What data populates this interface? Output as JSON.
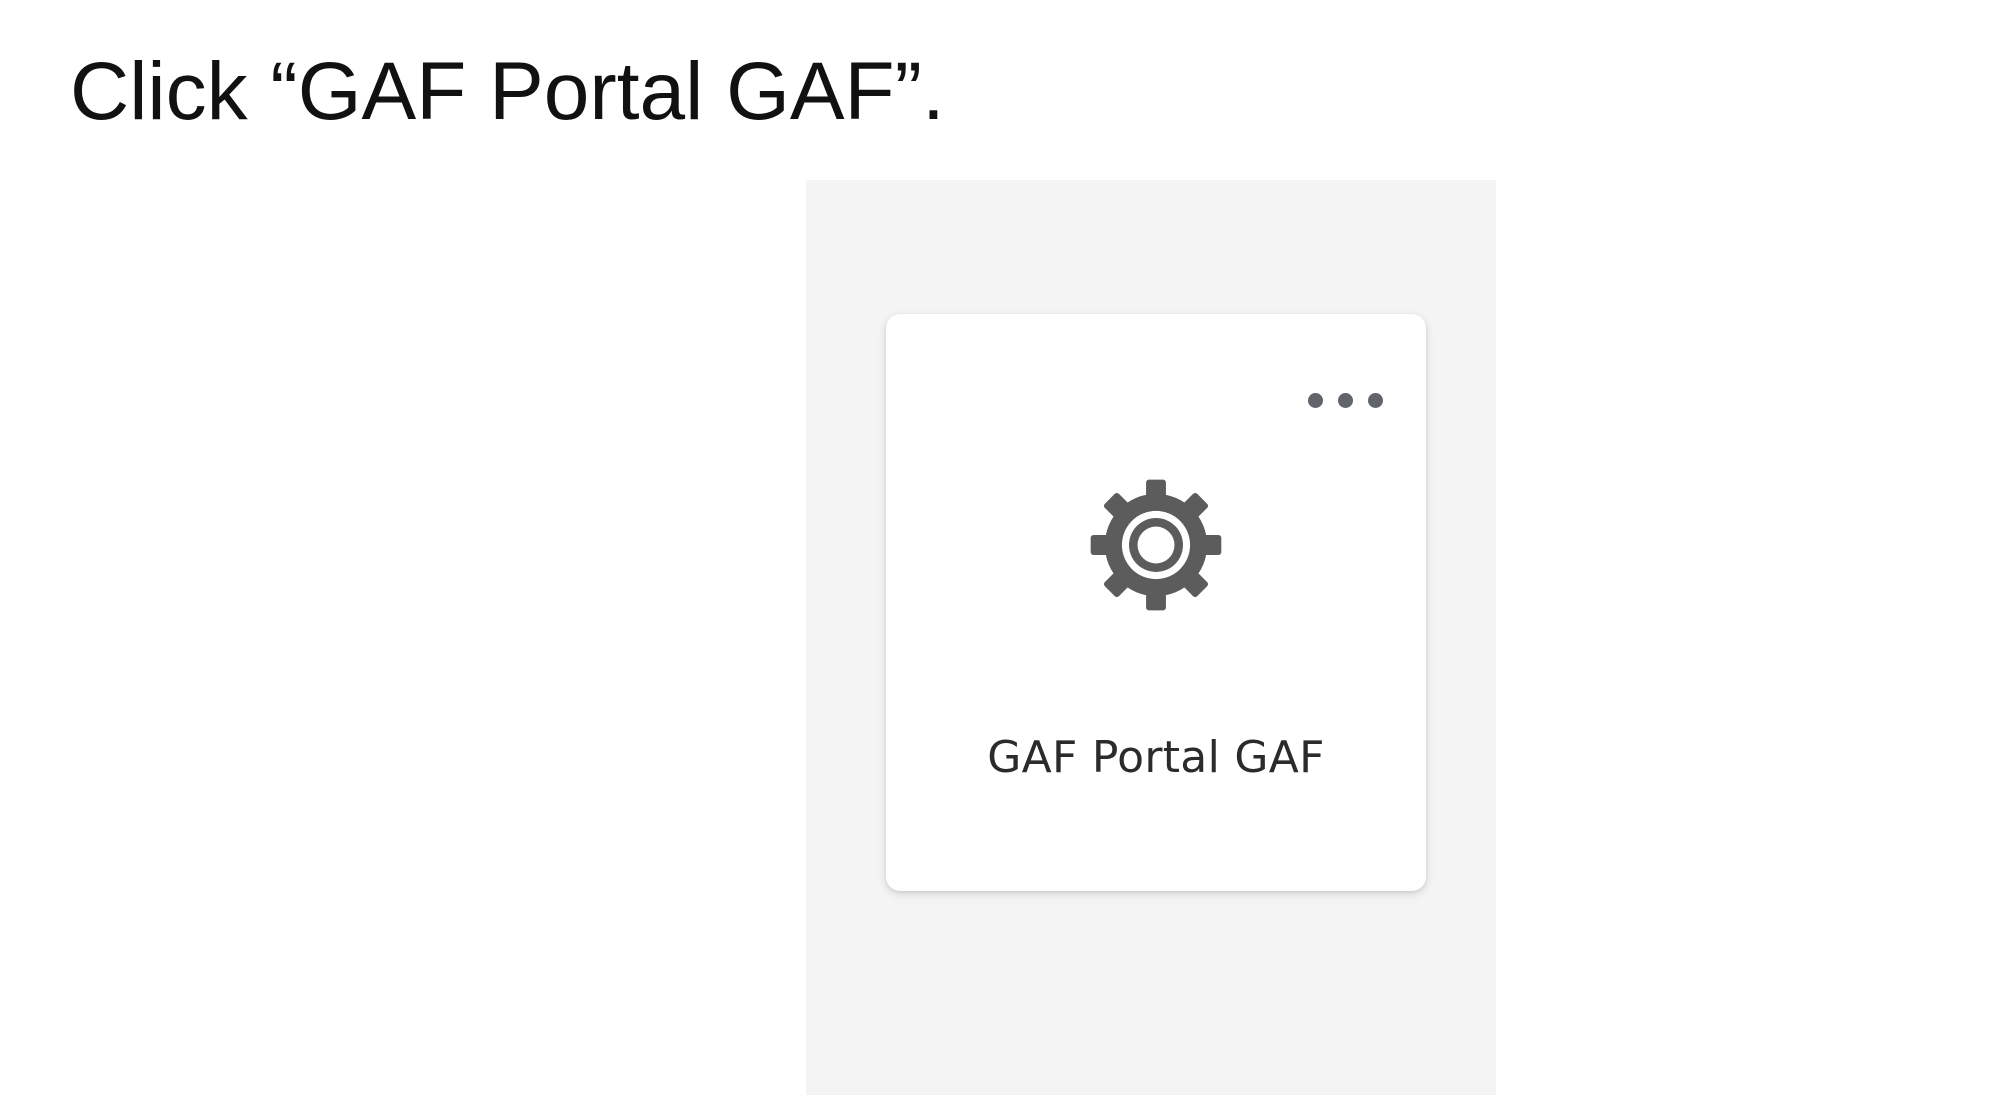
{
  "instruction": {
    "text": "Click “GAF Portal GAF”."
  },
  "tile": {
    "label": "GAF Portal GAF",
    "icon": "gear-icon",
    "menu_icon": "more-horizontal-icon"
  },
  "colors": {
    "panel_background": "#f4f4f4",
    "tile_background": "#ffffff",
    "icon_color": "#5c5c5c",
    "menu_dots": "#62646c",
    "label_text": "#2b2b2b"
  }
}
